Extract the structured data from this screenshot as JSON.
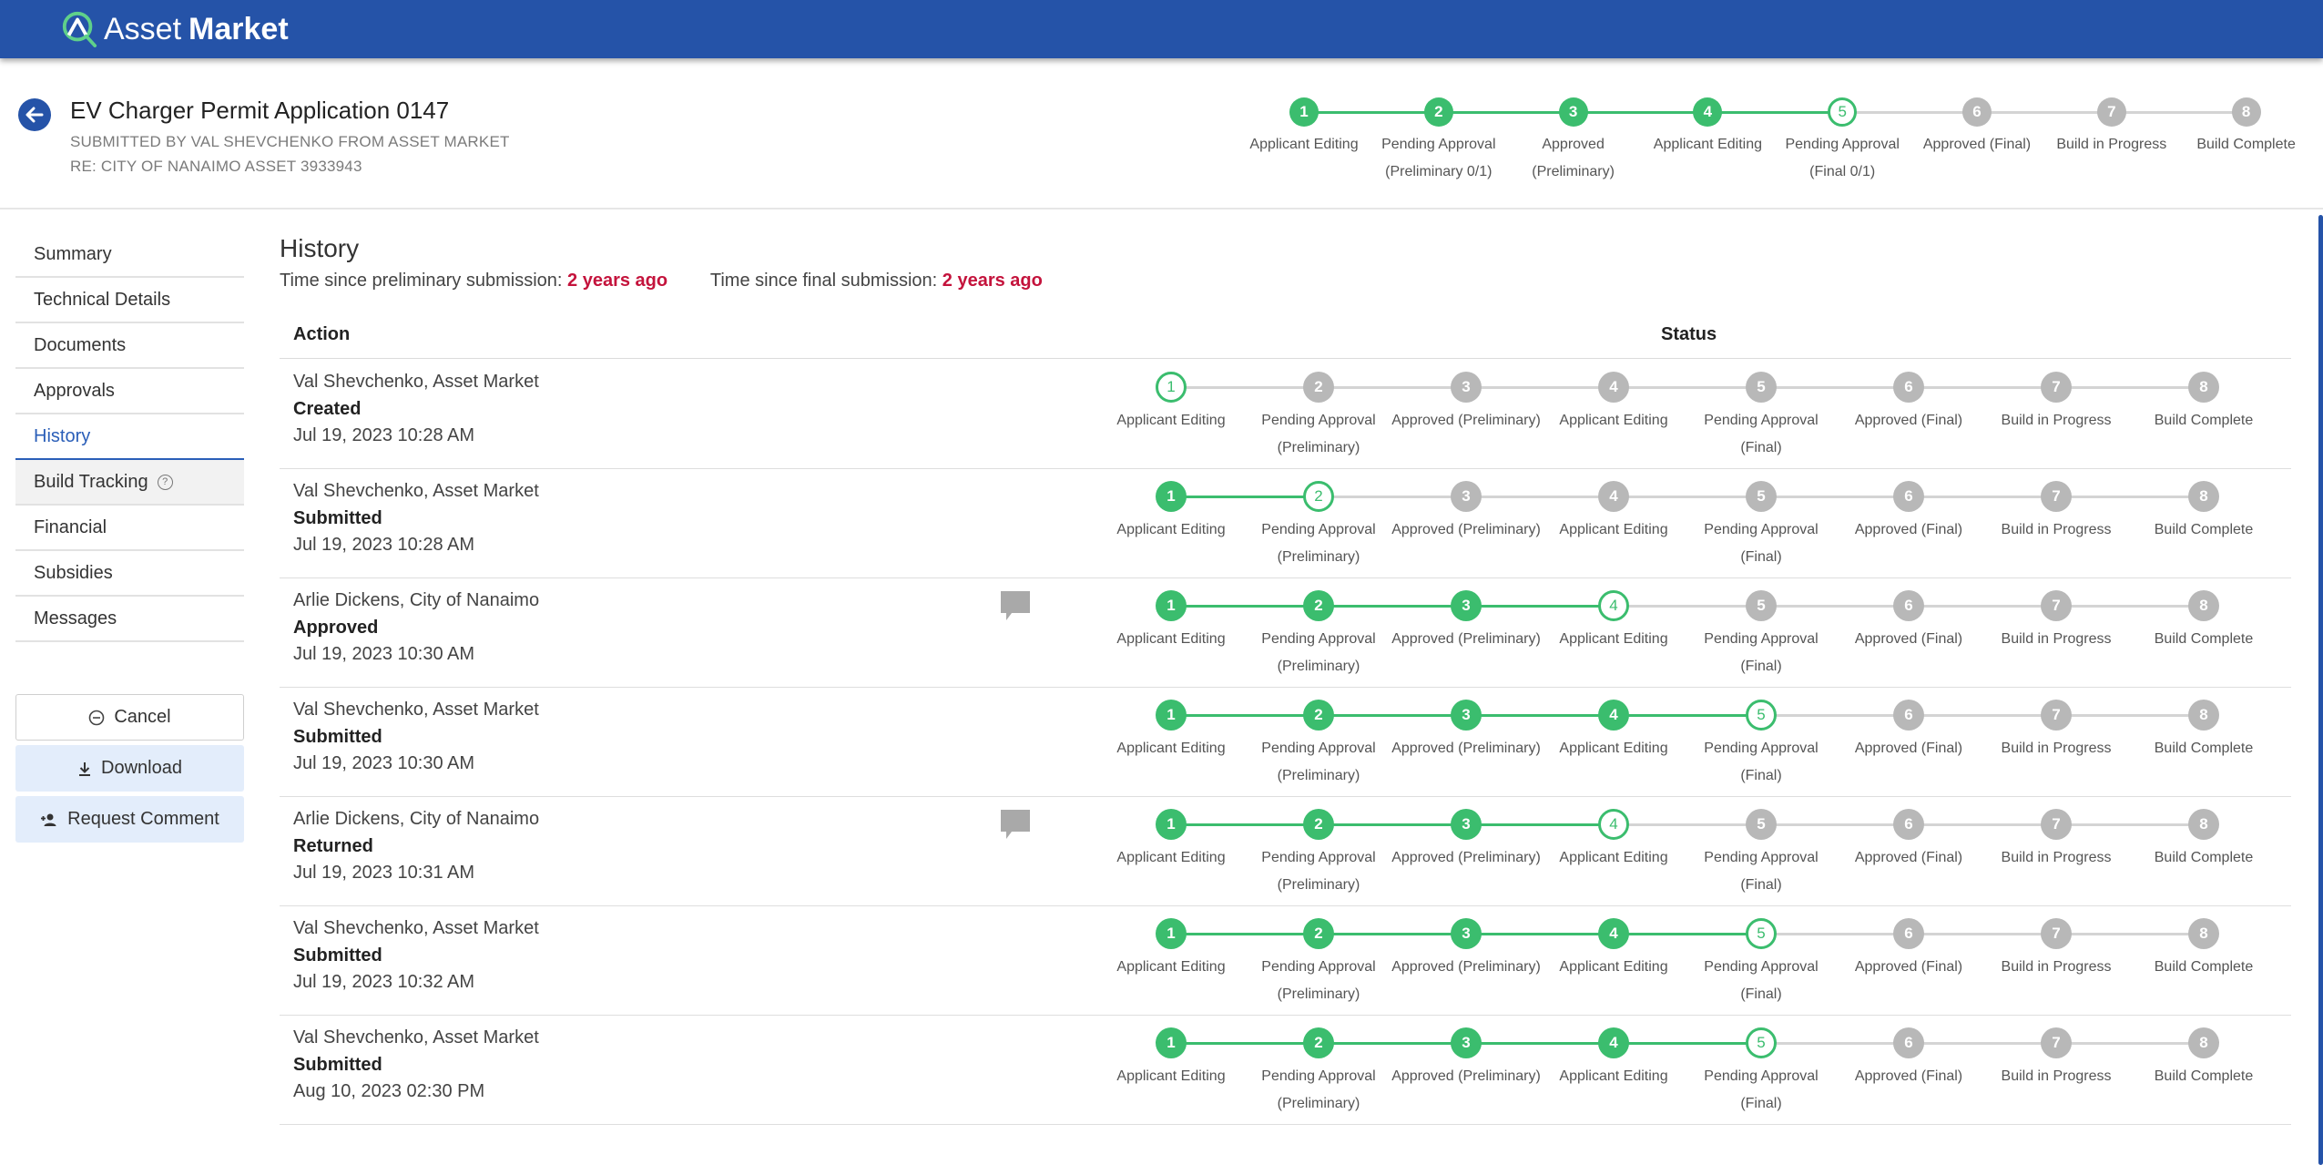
{
  "app": {
    "brand_part1": "Asset",
    "brand_part2": "Market",
    "colors": {
      "brand": "#2553a8",
      "done": "#3bbd6e",
      "todo": "#b8b8b8",
      "accent_red": "#c4133c"
    }
  },
  "header": {
    "title": "EV Charger Permit Application 0147",
    "submitted_by": "SUBMITTED BY VAL SHEVCHENKO FROM ASSET MARKET",
    "re": "RE: CITY OF NANAIMO ASSET 3933943",
    "back_icon": "arrow-left-icon",
    "stepper": {
      "current": 5,
      "steps": [
        {
          "num": "1",
          "line1": "Applicant Editing",
          "line2": ""
        },
        {
          "num": "2",
          "line1": "Pending Approval",
          "line2": "(Preliminary 0/1)"
        },
        {
          "num": "3",
          "line1": "Approved",
          "line2": "(Preliminary)"
        },
        {
          "num": "4",
          "line1": "Applicant Editing",
          "line2": ""
        },
        {
          "num": "5",
          "line1": "Pending Approval",
          "line2": "(Final 0/1)"
        },
        {
          "num": "6",
          "line1": "Approved (Final)",
          "line2": ""
        },
        {
          "num": "7",
          "line1": "Build in Progress",
          "line2": ""
        },
        {
          "num": "8",
          "line1": "Build Complete",
          "line2": ""
        }
      ]
    }
  },
  "sidebar": {
    "items": [
      {
        "label": "Summary",
        "active": false,
        "help": false
      },
      {
        "label": "Technical Details",
        "active": false,
        "help": false
      },
      {
        "label": "Documents",
        "active": false,
        "help": false
      },
      {
        "label": "Approvals",
        "active": false,
        "help": false
      },
      {
        "label": "History",
        "active": true,
        "help": false
      },
      {
        "label": "Build Tracking",
        "active": false,
        "help": true
      },
      {
        "label": "Financial",
        "active": false,
        "help": false
      },
      {
        "label": "Subsidies",
        "active": false,
        "help": false
      },
      {
        "label": "Messages",
        "active": false,
        "help": false
      }
    ],
    "buttons": {
      "cancel": "Cancel",
      "download": "Download",
      "request_comment": "Request Comment"
    }
  },
  "history": {
    "title": "History",
    "prelim_label": "Time since preliminary submission:",
    "prelim_value": "2 years ago",
    "final_label": "Time since final submission:",
    "final_value": "2 years ago",
    "col_action": "Action",
    "col_status": "Status",
    "step_labels": [
      {
        "num": "1",
        "line1": "Applicant Editing",
        "line2": ""
      },
      {
        "num": "2",
        "line1": "Pending Approval",
        "line2": "(Preliminary)"
      },
      {
        "num": "3",
        "line1": "Approved (Preliminary)",
        "line2": ""
      },
      {
        "num": "4",
        "line1": "Applicant Editing",
        "line2": ""
      },
      {
        "num": "5",
        "line1": "Pending Approval",
        "line2": "(Final)"
      },
      {
        "num": "6",
        "line1": "Approved (Final)",
        "line2": ""
      },
      {
        "num": "7",
        "line1": "Build in Progress",
        "line2": ""
      },
      {
        "num": "8",
        "line1": "Build Complete",
        "line2": ""
      }
    ],
    "rows": [
      {
        "who": "Val Shevchenko, Asset Market",
        "action": "Created",
        "when": "Jul 19, 2023 10:28 AM",
        "current": 1,
        "comment": false
      },
      {
        "who": "Val Shevchenko, Asset Market",
        "action": "Submitted",
        "when": "Jul 19, 2023 10:28 AM",
        "current": 2,
        "comment": false
      },
      {
        "who": "Arlie Dickens, City of Nanaimo",
        "action": "Approved",
        "when": "Jul 19, 2023 10:30 AM",
        "current": 4,
        "comment": true
      },
      {
        "who": "Val Shevchenko, Asset Market",
        "action": "Submitted",
        "when": "Jul 19, 2023 10:30 AM",
        "current": 5,
        "comment": false
      },
      {
        "who": "Arlie Dickens, City of Nanaimo",
        "action": "Returned",
        "when": "Jul 19, 2023 10:31 AM",
        "current": 4,
        "comment": true
      },
      {
        "who": "Val Shevchenko, Asset Market",
        "action": "Submitted",
        "when": "Jul 19, 2023 10:32 AM",
        "current": 5,
        "comment": false
      },
      {
        "who": "Val Shevchenko, Asset Market",
        "action": "Submitted",
        "when": "Aug 10, 2023 02:30 PM",
        "current": 5,
        "comment": false
      }
    ]
  }
}
